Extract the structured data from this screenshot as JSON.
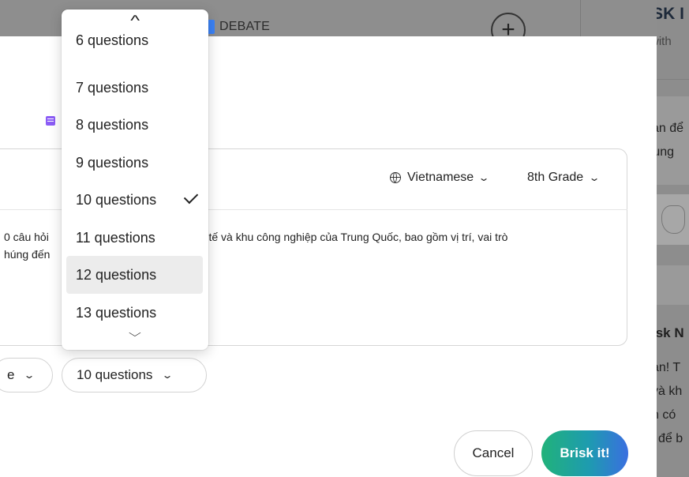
{
  "background": {
    "debate_label": "DEBATE",
    "plus_label": "+",
    "sidebar": {
      "title_fragment": "BRISK I",
      "subtitle_fragment": "with",
      "line1": "ản để",
      "line2": "rung",
      "section_title_fragment": "isk N",
      "para1": "ạn! T",
      "para2": "và kh",
      "para3": "n có",
      "para4": "i để b"
    }
  },
  "card": {
    "language_label": "Vietnamese",
    "grade_label": "8th Grade",
    "prompt_left_1": "0 câu hỏi",
    "prompt_right_1": "nh tế và khu công nghiệp của Trung Quốc, bao gồm vị trí, vai trò",
    "prompt_left_2": "húng đến"
  },
  "pills": {
    "language_fragment": "e",
    "questions_label": "10 questions"
  },
  "dropdown": {
    "scroll_up_glyph": "^",
    "scroll_down_glyph": "v",
    "options": [
      {
        "label": "6 questions"
      },
      {
        "label": "7 questions"
      },
      {
        "label": "8 questions"
      },
      {
        "label": "9 questions"
      },
      {
        "label": "10 questions",
        "selected": true
      },
      {
        "label": "11 questions"
      },
      {
        "label": "12 questions",
        "hovered": true
      },
      {
        "label": "13 questions"
      }
    ]
  },
  "actions": {
    "cancel_label": "Cancel",
    "brisk_label": "Brisk it!"
  },
  "colors": {
    "accent_green": "#21b27a",
    "accent_blue": "#3a6fe0",
    "debate_icon": "#3b82f6",
    "list_icon": "#8b5cf6"
  }
}
